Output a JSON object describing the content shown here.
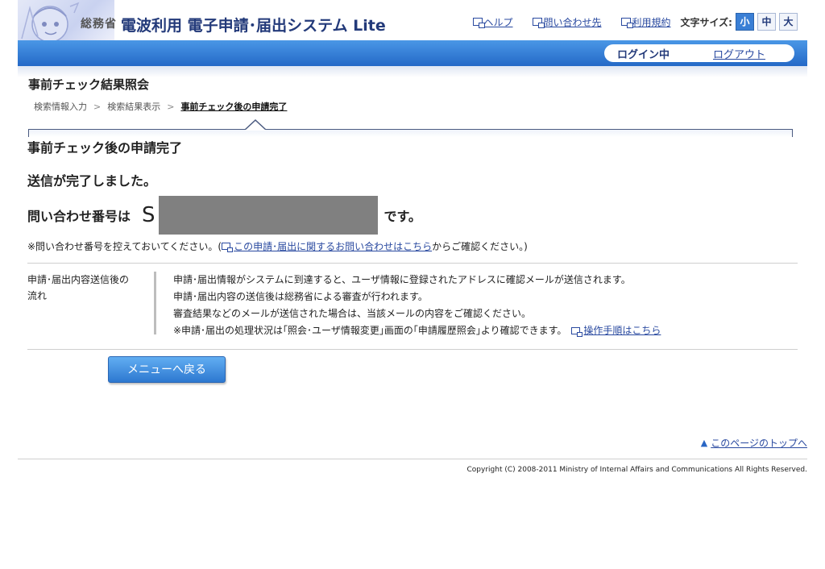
{
  "header": {
    "ministry": "総務省",
    "system_title": "電波利用 電子申請･届出システム Lite",
    "links": {
      "help": "ヘルプ",
      "contact": "問い合わせ先",
      "terms": "利用規約"
    },
    "font_size_label": "文字サイズ:",
    "font_sizes": {
      "small": "小",
      "medium": "中",
      "large": "大"
    }
  },
  "status": {
    "login": "ログイン中",
    "logout": "ログアウト"
  },
  "page": {
    "heading": "事前チェック結果照会",
    "breadcrumb": {
      "step1": "検索情報入力",
      "step2": "検索結果表示",
      "step3": "事前チェック後の申請完了"
    }
  },
  "main": {
    "section_title": "事前チェック後の申請完了",
    "complete_message": "送信が完了しました。",
    "inquiry_label": "問い合わせ番号は",
    "inquiry_prefix": "S",
    "inquiry_suffix": "です。",
    "note_before": "※問い合わせ番号を控えておいてください。(",
    "note_link": "この申請･届出に関するお問い合わせはこちら",
    "note_after": "からご確認ください。)"
  },
  "flow": {
    "label_line1": "申請･届出内容送信後の",
    "label_line2": "流れ",
    "line1": "申請･届出情報がシステムに到達すると、ユーザ情報に登録されたアドレスに確認メールが送信されます。",
    "line2": "申請･届出内容の送信後は総務省による審査が行われます。",
    "line3": "審査結果などのメールが送信された場合は、当該メールの内容をご確認ください。",
    "line4": "※申請･届出の処理状況は｢照会･ユーザ情報変更｣画面の｢申請履歴照会｣より確認できます。",
    "line4_link": "操作手順はこちら"
  },
  "actions": {
    "menu_button": "メニューへ戻る"
  },
  "footer": {
    "page_top": "このページのトップへ",
    "copyright": "Copyright (C) 2008-2011 Ministry of Internal Affairs and Communications All Rights Reserved."
  },
  "colors": {
    "brand_blue": "#2469c7",
    "link": "#2a4aa0",
    "title": "#233a7a"
  }
}
